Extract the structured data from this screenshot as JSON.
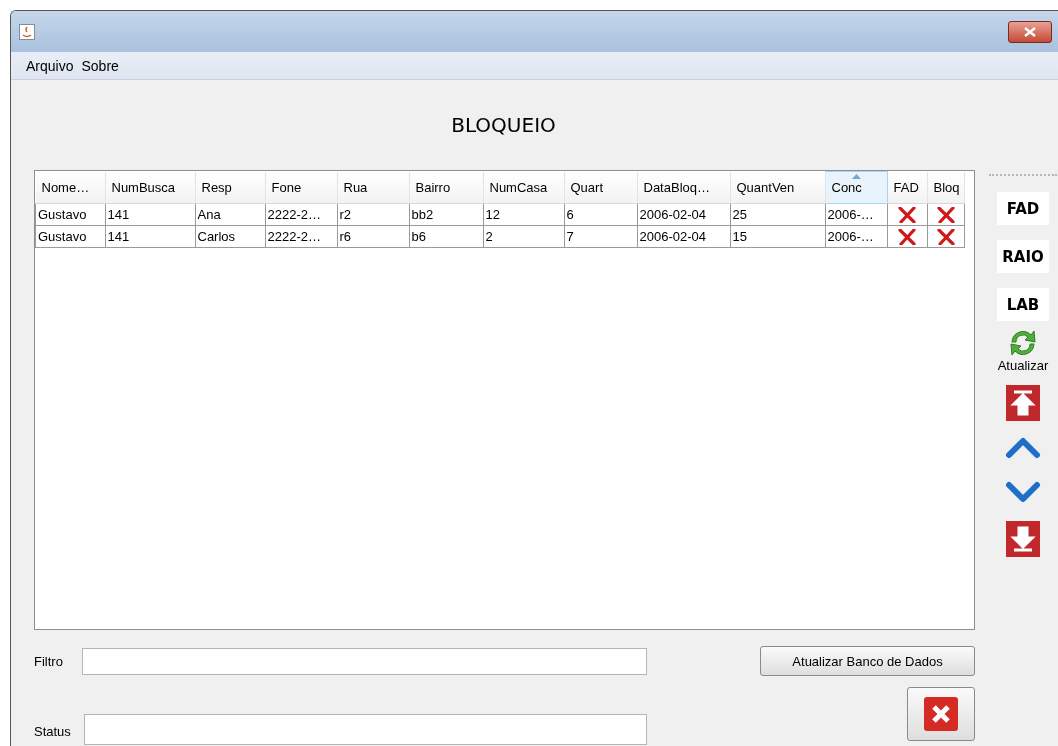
{
  "menu": [
    {
      "label": "Arquivo"
    },
    {
      "label": "Sobre"
    }
  ],
  "heading": "BLOQUEIO",
  "table": {
    "columns": [
      {
        "label": "Nome…",
        "kind": "text",
        "sorted": false
      },
      {
        "label": "NumBusca",
        "kind": "text",
        "sorted": false
      },
      {
        "label": "Resp",
        "kind": "text",
        "sorted": false
      },
      {
        "label": "Fone",
        "kind": "text",
        "sorted": false
      },
      {
        "label": "Rua",
        "kind": "text",
        "sorted": false
      },
      {
        "label": "Bairro",
        "kind": "text",
        "sorted": false
      },
      {
        "label": "NumCasa",
        "kind": "text",
        "sorted": false
      },
      {
        "label": "Quart",
        "kind": "text",
        "sorted": false
      },
      {
        "label": "DataBloq…",
        "kind": "text",
        "sorted": false
      },
      {
        "label": "QuantVen",
        "kind": "text",
        "sorted": false
      },
      {
        "label": "Conc",
        "kind": "text",
        "sorted": true
      },
      {
        "label": "FAD",
        "kind": "flag",
        "sorted": false
      },
      {
        "label": "Bloq",
        "kind": "flag",
        "sorted": false
      }
    ],
    "rows": [
      {
        "cells": [
          "Gustavo",
          "141",
          "Ana",
          "2222-2…",
          "r2",
          "bb2",
          "12",
          "6",
          "2006-02-04",
          "25",
          "2006-…",
          false,
          false
        ]
      },
      {
        "cells": [
          "Gustavo",
          "141",
          "Carlos",
          "2222-2…",
          "r6",
          "b6",
          "2",
          "7",
          "2006-02-04",
          "15",
          "2006-…",
          false,
          false
        ]
      }
    ]
  },
  "side_tools": [
    {
      "kind": "text",
      "label": "FAD"
    },
    {
      "kind": "text",
      "label": "RAIO"
    },
    {
      "kind": "text",
      "label": "LAB"
    },
    {
      "kind": "refresh",
      "label": "Atualizar"
    },
    {
      "kind": "first"
    },
    {
      "kind": "up"
    },
    {
      "kind": "down"
    },
    {
      "kind": "last"
    }
  ],
  "filter": {
    "label": "Filtro"
  },
  "update_button": "Atualizar Banco de Dados",
  "status": {
    "label": "Status"
  }
}
